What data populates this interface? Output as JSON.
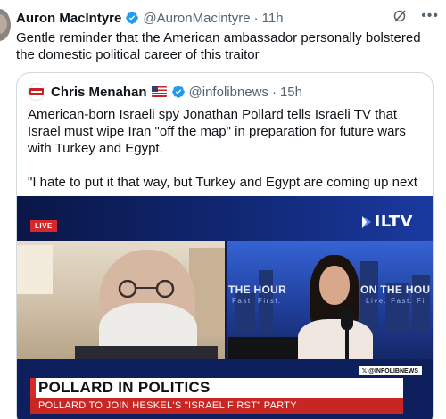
{
  "tweet": {
    "author_name": "Auron MacIntyre",
    "handle": "@AuronMacintyre",
    "separator": "·",
    "time": "11h",
    "text": "Gentle reminder that the American ambassador personally bolstered the domestic political career of this traitor"
  },
  "icons": {
    "verified_badge": "verified-badge-icon",
    "grok": "grok-icon",
    "more": "more-icon",
    "flag": "us-flag-icon",
    "live_logo": "iltv-logo-icon"
  },
  "quote": {
    "author_name": "Chris Menahan",
    "handle": "@infolibnews",
    "separator": "·",
    "time": "15h",
    "paragraph1": "American-born Israeli spy Jonathan Pollard tells Israeli TV that Israel must wipe Iran \"off the map\" in preparation for future wars with Turkey and Egypt.",
    "paragraph2": "\"I hate to put it that way, but Turkey and Egypt are coming up next as ..."
  },
  "video": {
    "live_label": "LIVE",
    "channel_name": "ILTV",
    "background_text_left": "THE HOUR",
    "background_text_right": "ON THE HOU",
    "background_sub_left": "Fast. First.",
    "background_sub_right": "Live. Fast. Fi",
    "handle_tag": "𝕏 @INFOLIBNEWS",
    "headline": "POLLARD IN POLITICS",
    "subline": "POLLARD TO JOIN HESKEL'S \"ISRAEL FIRST\" PARTY"
  },
  "colors": {
    "verified_blue": "#1d9bf0",
    "text": "#0f1419",
    "secondary_text": "#536471",
    "border": "#cfd9de",
    "live_red": "#d62a2a",
    "news_navy": "#0d1f5c"
  }
}
